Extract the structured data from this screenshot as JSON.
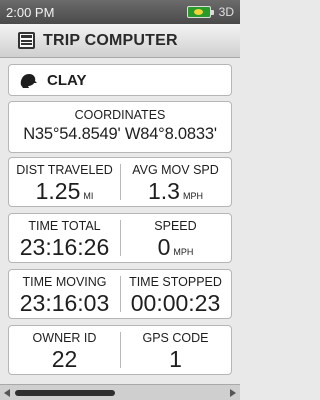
{
  "status": {
    "time": "2:00 PM",
    "view_mode": "3D",
    "battery_icon": "battery-icon"
  },
  "header": {
    "title": "TRIP COMPUTER",
    "icon": "trip-computer-icon"
  },
  "profile": {
    "name": "CLAY",
    "icon": "person-profile-icon"
  },
  "coordinates": {
    "label": "COORDINATES",
    "value": "N35°54.8549' W84°8.0833'"
  },
  "fields": [
    {
      "label": "DIST TRAVELED",
      "value": "1.25",
      "unit": "MI"
    },
    {
      "label": "AVG MOV SPD",
      "value": "1.3",
      "unit": "MPH"
    },
    {
      "label": "TIME TOTAL",
      "value": "23:16:26",
      "unit": ""
    },
    {
      "label": "SPEED",
      "value": "0",
      "unit": "MPH"
    },
    {
      "label": "TIME MOVING",
      "value": "23:16:03",
      "unit": ""
    },
    {
      "label": "TIME STOPPED",
      "value": "00:00:23",
      "unit": ""
    },
    {
      "label": "OWNER ID",
      "value": "22",
      "unit": ""
    },
    {
      "label": "GPS CODE",
      "value": "1",
      "unit": ""
    }
  ],
  "colors": {
    "battery": "#2a9a2a",
    "status_bg": "#555555"
  }
}
